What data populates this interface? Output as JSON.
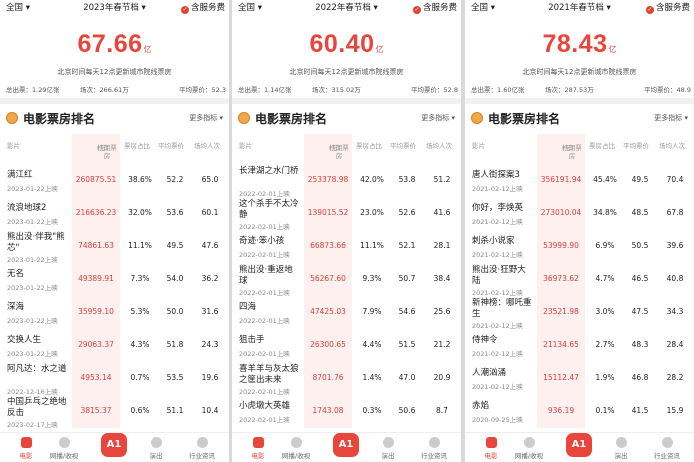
{
  "colors": {
    "accent": "#e8453c",
    "box_office_text": "#d8403a"
  },
  "panels": [
    {
      "region": "全国",
      "season": "2023年春节档",
      "service": "含服务费",
      "big_value": "67.66",
      "big_unit": "亿",
      "subtitle": "北京时间每天12点更新城市院线票房",
      "stats": [
        "总出票：1.29亿张",
        "场次：266.61万",
        "平均票价：52.3"
      ],
      "ranking_title": "电影票房排名",
      "more_label": "更多指标",
      "headers": {
        "film": "影片",
        "box": "档期票房",
        "box_unit": "(万)",
        "share": "票房占比",
        "avg_price": "平均票价",
        "avg_people": "场均人次"
      },
      "movies": [
        {
          "name": "满江红",
          "date": "2023-01-22上映",
          "box": "260875.51",
          "share": "38.6%",
          "price": "52.2",
          "people": "65.0"
        },
        {
          "name": "流浪地球2",
          "date": "2023-01-22上映",
          "box": "216636.23",
          "share": "32.0%",
          "price": "53.6",
          "people": "60.1"
        },
        {
          "name": "熊出没·伴我\"熊芯\"",
          "date": "2023-01-22上映",
          "box": "74861.63",
          "share": "11.1%",
          "price": "49.5",
          "people": "47.6"
        },
        {
          "name": "无名",
          "date": "2023-01-22上映",
          "box": "49389.91",
          "share": "7.3%",
          "price": "54.0",
          "people": "36.2"
        },
        {
          "name": "深海",
          "date": "2023-01-22上映",
          "box": "35959.10",
          "share": "5.3%",
          "price": "50.0",
          "people": "31.6"
        },
        {
          "name": "交换人生",
          "date": "2023-01-22上映",
          "box": "29063.37",
          "share": "4.3%",
          "price": "51.8",
          "people": "24.3"
        },
        {
          "name": "阿凡达：水之道",
          "date": "2022-12-16上映",
          "box": "4953.14",
          "share": "0.7%",
          "price": "53.5",
          "people": "19.6"
        },
        {
          "name": "中国乒乓之绝地反击",
          "date": "2023-02-17上映",
          "box": "3815.37",
          "share": "0.6%",
          "price": "51.1",
          "people": "10.4"
        }
      ]
    },
    {
      "region": "全国",
      "season": "2022年春节档",
      "service": "含服务费",
      "big_value": "60.40",
      "big_unit": "亿",
      "subtitle": "北京时间每天12点更新城市院线票房",
      "stats": [
        "总出票：1.14亿张",
        "场次：315.02万",
        "平均票价：52.8"
      ],
      "ranking_title": "电影票房排名",
      "more_label": "更多指标",
      "headers": {
        "film": "影片",
        "box": "档期票房",
        "box_unit": "(万)",
        "share": "票房占比",
        "avg_price": "平均票价",
        "avg_people": "场均人次"
      },
      "movies": [
        {
          "name": "长津湖之水门桥",
          "date": "2022-02-01上映",
          "box": "253378.98",
          "share": "42.0%",
          "price": "53.8",
          "people": "51.2"
        },
        {
          "name": "这个杀手不太冷静",
          "date": "2022-02-01上映",
          "box": "139015.52",
          "share": "23.0%",
          "price": "52.6",
          "people": "41.6"
        },
        {
          "name": "奇迹·笨小孩",
          "date": "2022-02-01上映",
          "box": "66873.66",
          "share": "11.1%",
          "price": "52.1",
          "people": "28.1"
        },
        {
          "name": "熊出没·重返地球",
          "date": "2022-02-01上映",
          "box": "56267.60",
          "share": "9.3%",
          "price": "50.7",
          "people": "38.4"
        },
        {
          "name": "四海",
          "date": "2022-02-01上映",
          "box": "47425.03",
          "share": "7.9%",
          "price": "54.6",
          "people": "25.6"
        },
        {
          "name": "狙击手",
          "date": "2022-02-01上映",
          "box": "26300.65",
          "share": "4.4%",
          "price": "51.5",
          "people": "21.2"
        },
        {
          "name": "喜羊羊与灰太狼之筐出未来",
          "date": "2022-02-01上映",
          "box": "8701.76",
          "share": "1.4%",
          "price": "47.0",
          "people": "20.9"
        },
        {
          "name": "小虎墩大英雄",
          "date": "2022-02-01上映",
          "box": "1743.08",
          "share": "0.3%",
          "price": "50.6",
          "people": "8.7"
        }
      ]
    },
    {
      "region": "全国",
      "season": "2021年春节档",
      "service": "含服务费",
      "big_value": "78.43",
      "big_unit": "亿",
      "subtitle": "北京时间每天12点更新城市院线票房",
      "stats": [
        "总出票：1.60亿张",
        "场次：287.53万",
        "平均票价：48.9"
      ],
      "ranking_title": "电影票房排名",
      "more_label": "更多指标",
      "headers": {
        "film": "影片",
        "box": "档期票房",
        "box_unit": "(万)",
        "share": "票房占比",
        "avg_price": "平均票价",
        "avg_people": "场均人次"
      },
      "movies": [
        {
          "name": "唐人街探案3",
          "date": "2021-02-12上映",
          "box": "356191.94",
          "share": "45.4%",
          "price": "49.5",
          "people": "70.4"
        },
        {
          "name": "你好，李焕英",
          "date": "2021-02-12上映",
          "box": "273010.04",
          "share": "34.8%",
          "price": "48.5",
          "people": "67.8"
        },
        {
          "name": "刺杀小说家",
          "date": "2021-02-12上映",
          "box": "53999.90",
          "share": "6.9%",
          "price": "50.5",
          "people": "39.6"
        },
        {
          "name": "熊出没·狂野大陆",
          "date": "2021-02-12上映",
          "box": "36973.62",
          "share": "4.7%",
          "price": "46.5",
          "people": "40.8"
        },
        {
          "name": "新神榜：哪吒重生",
          "date": "2021-02-12上映",
          "box": "23521.98",
          "share": "3.0%",
          "price": "47.5",
          "people": "34.3"
        },
        {
          "name": "侍神令",
          "date": "2021-02-12上映",
          "box": "21134.65",
          "share": "2.7%",
          "price": "48.3",
          "people": "28.4"
        },
        {
          "name": "人潮汹涌",
          "date": "2021-02-12上映",
          "box": "15112.47",
          "share": "1.9%",
          "price": "46.8",
          "people": "28.2"
        },
        {
          "name": "赤焰",
          "date": "2020-09-25上映",
          "box": "936.19",
          "share": "0.1%",
          "price": "41.5",
          "people": "15.9"
        }
      ]
    }
  ],
  "nav": {
    "movie": "电影",
    "network": "网播/收视",
    "center": "A1",
    "show": "演出",
    "industry": "行业资讯"
  }
}
